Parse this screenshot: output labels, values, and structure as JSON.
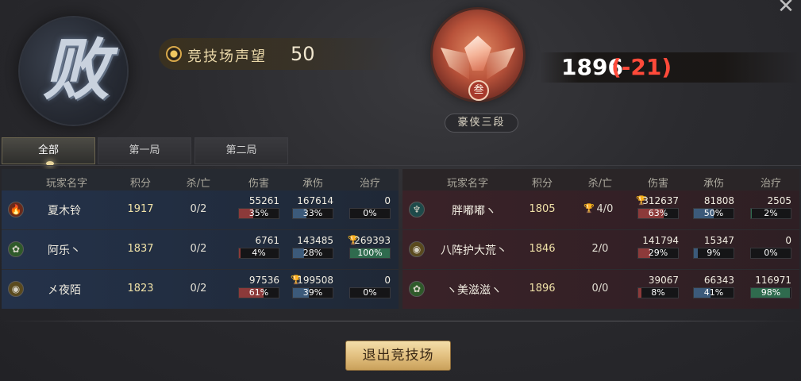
{
  "header": {
    "result_text": "败",
    "prestige_label": "竞技场声望",
    "prestige_value": "50",
    "rank_numeral": "叁",
    "rank_name": "豪侠三段",
    "rating_value": "1896",
    "rating_delta": "(-21)",
    "close_label": "✕"
  },
  "tabs": [
    {
      "label": "全部",
      "active": true
    },
    {
      "label": "第一局",
      "active": false
    },
    {
      "label": "第二局",
      "active": false
    }
  ],
  "columns": [
    "玩家名字",
    "积分",
    "杀/亡",
    "伤害",
    "承伤",
    "治疗"
  ],
  "teams": {
    "ally": [
      {
        "icon": "flame-icon",
        "icon_glyph": "🔥",
        "icon_bg": "#6b2a1a",
        "name": "夏木铃",
        "score": "1917",
        "kd": "0/2",
        "damage": "55261",
        "damage_pct": "35%",
        "damage_frac": 0.35,
        "damage_top": false,
        "tank": "167614",
        "tank_pct": "33%",
        "tank_frac": 0.33,
        "tank_top": false,
        "heal": "0",
        "heal_pct": "0%",
        "heal_frac": 0,
        "heal_top": false
      },
      {
        "icon": "leaf-icon",
        "icon_glyph": "✿",
        "icon_bg": "#2f5a2a",
        "name": "阿乐丶",
        "score": "1837",
        "kd": "0/2",
        "damage": "6761",
        "damage_pct": "4%",
        "damage_frac": 0.04,
        "damage_top": false,
        "tank": "143485",
        "tank_pct": "28%",
        "tank_frac": 0.28,
        "tank_top": false,
        "heal": "269393",
        "heal_pct": "100%",
        "heal_frac": 1.0,
        "heal_top": true
      },
      {
        "icon": "orb-icon",
        "icon_glyph": "◉",
        "icon_bg": "#5a4a1e",
        "name": "㐅夜陌",
        "score": "1823",
        "kd": "0/2",
        "damage": "97536",
        "damage_pct": "61%",
        "damage_frac": 0.61,
        "damage_top": false,
        "tank": "199508",
        "tank_pct": "39%",
        "tank_frac": 0.39,
        "tank_top": true,
        "heal": "0",
        "heal_pct": "0%",
        "heal_frac": 0,
        "heal_top": false
      }
    ],
    "enemy": [
      {
        "icon": "trident-icon",
        "icon_glyph": "♆",
        "icon_bg": "#1e4a4a",
        "name": "胖嘟嘟ヽ",
        "score": "1805",
        "kd": "4/0",
        "kd_top": true,
        "damage": "312637",
        "damage_pct": "63%",
        "damage_frac": 0.63,
        "damage_top": true,
        "tank": "81808",
        "tank_pct": "50%",
        "tank_frac": 0.5,
        "tank_top": false,
        "heal": "2505",
        "heal_pct": "2%",
        "heal_frac": 0.02,
        "heal_top": false
      },
      {
        "icon": "orb-icon",
        "icon_glyph": "◉",
        "icon_bg": "#5a4a1e",
        "name": "八阵护大荒丶",
        "score": "1846",
        "kd": "2/0",
        "kd_top": false,
        "damage": "141794",
        "damage_pct": "29%",
        "damage_frac": 0.29,
        "damage_top": false,
        "tank": "15347",
        "tank_pct": "9%",
        "tank_frac": 0.09,
        "tank_top": false,
        "heal": "0",
        "heal_pct": "0%",
        "heal_frac": 0,
        "heal_top": false
      },
      {
        "icon": "leaf-icon",
        "icon_glyph": "✿",
        "icon_bg": "#2f5a2a",
        "name": "ヽ美滋滋ヽ",
        "score": "1896",
        "kd": "0/0",
        "kd_top": false,
        "damage": "39067",
        "damage_pct": "8%",
        "damage_frac": 0.08,
        "damage_top": false,
        "tank": "66343",
        "tank_pct": "41%",
        "tank_frac": 0.41,
        "tank_top": false,
        "heal": "116971",
        "heal_pct": "98%",
        "heal_frac": 0.98,
        "heal_top": false
      }
    ]
  },
  "exit_button": "退出竞技场"
}
